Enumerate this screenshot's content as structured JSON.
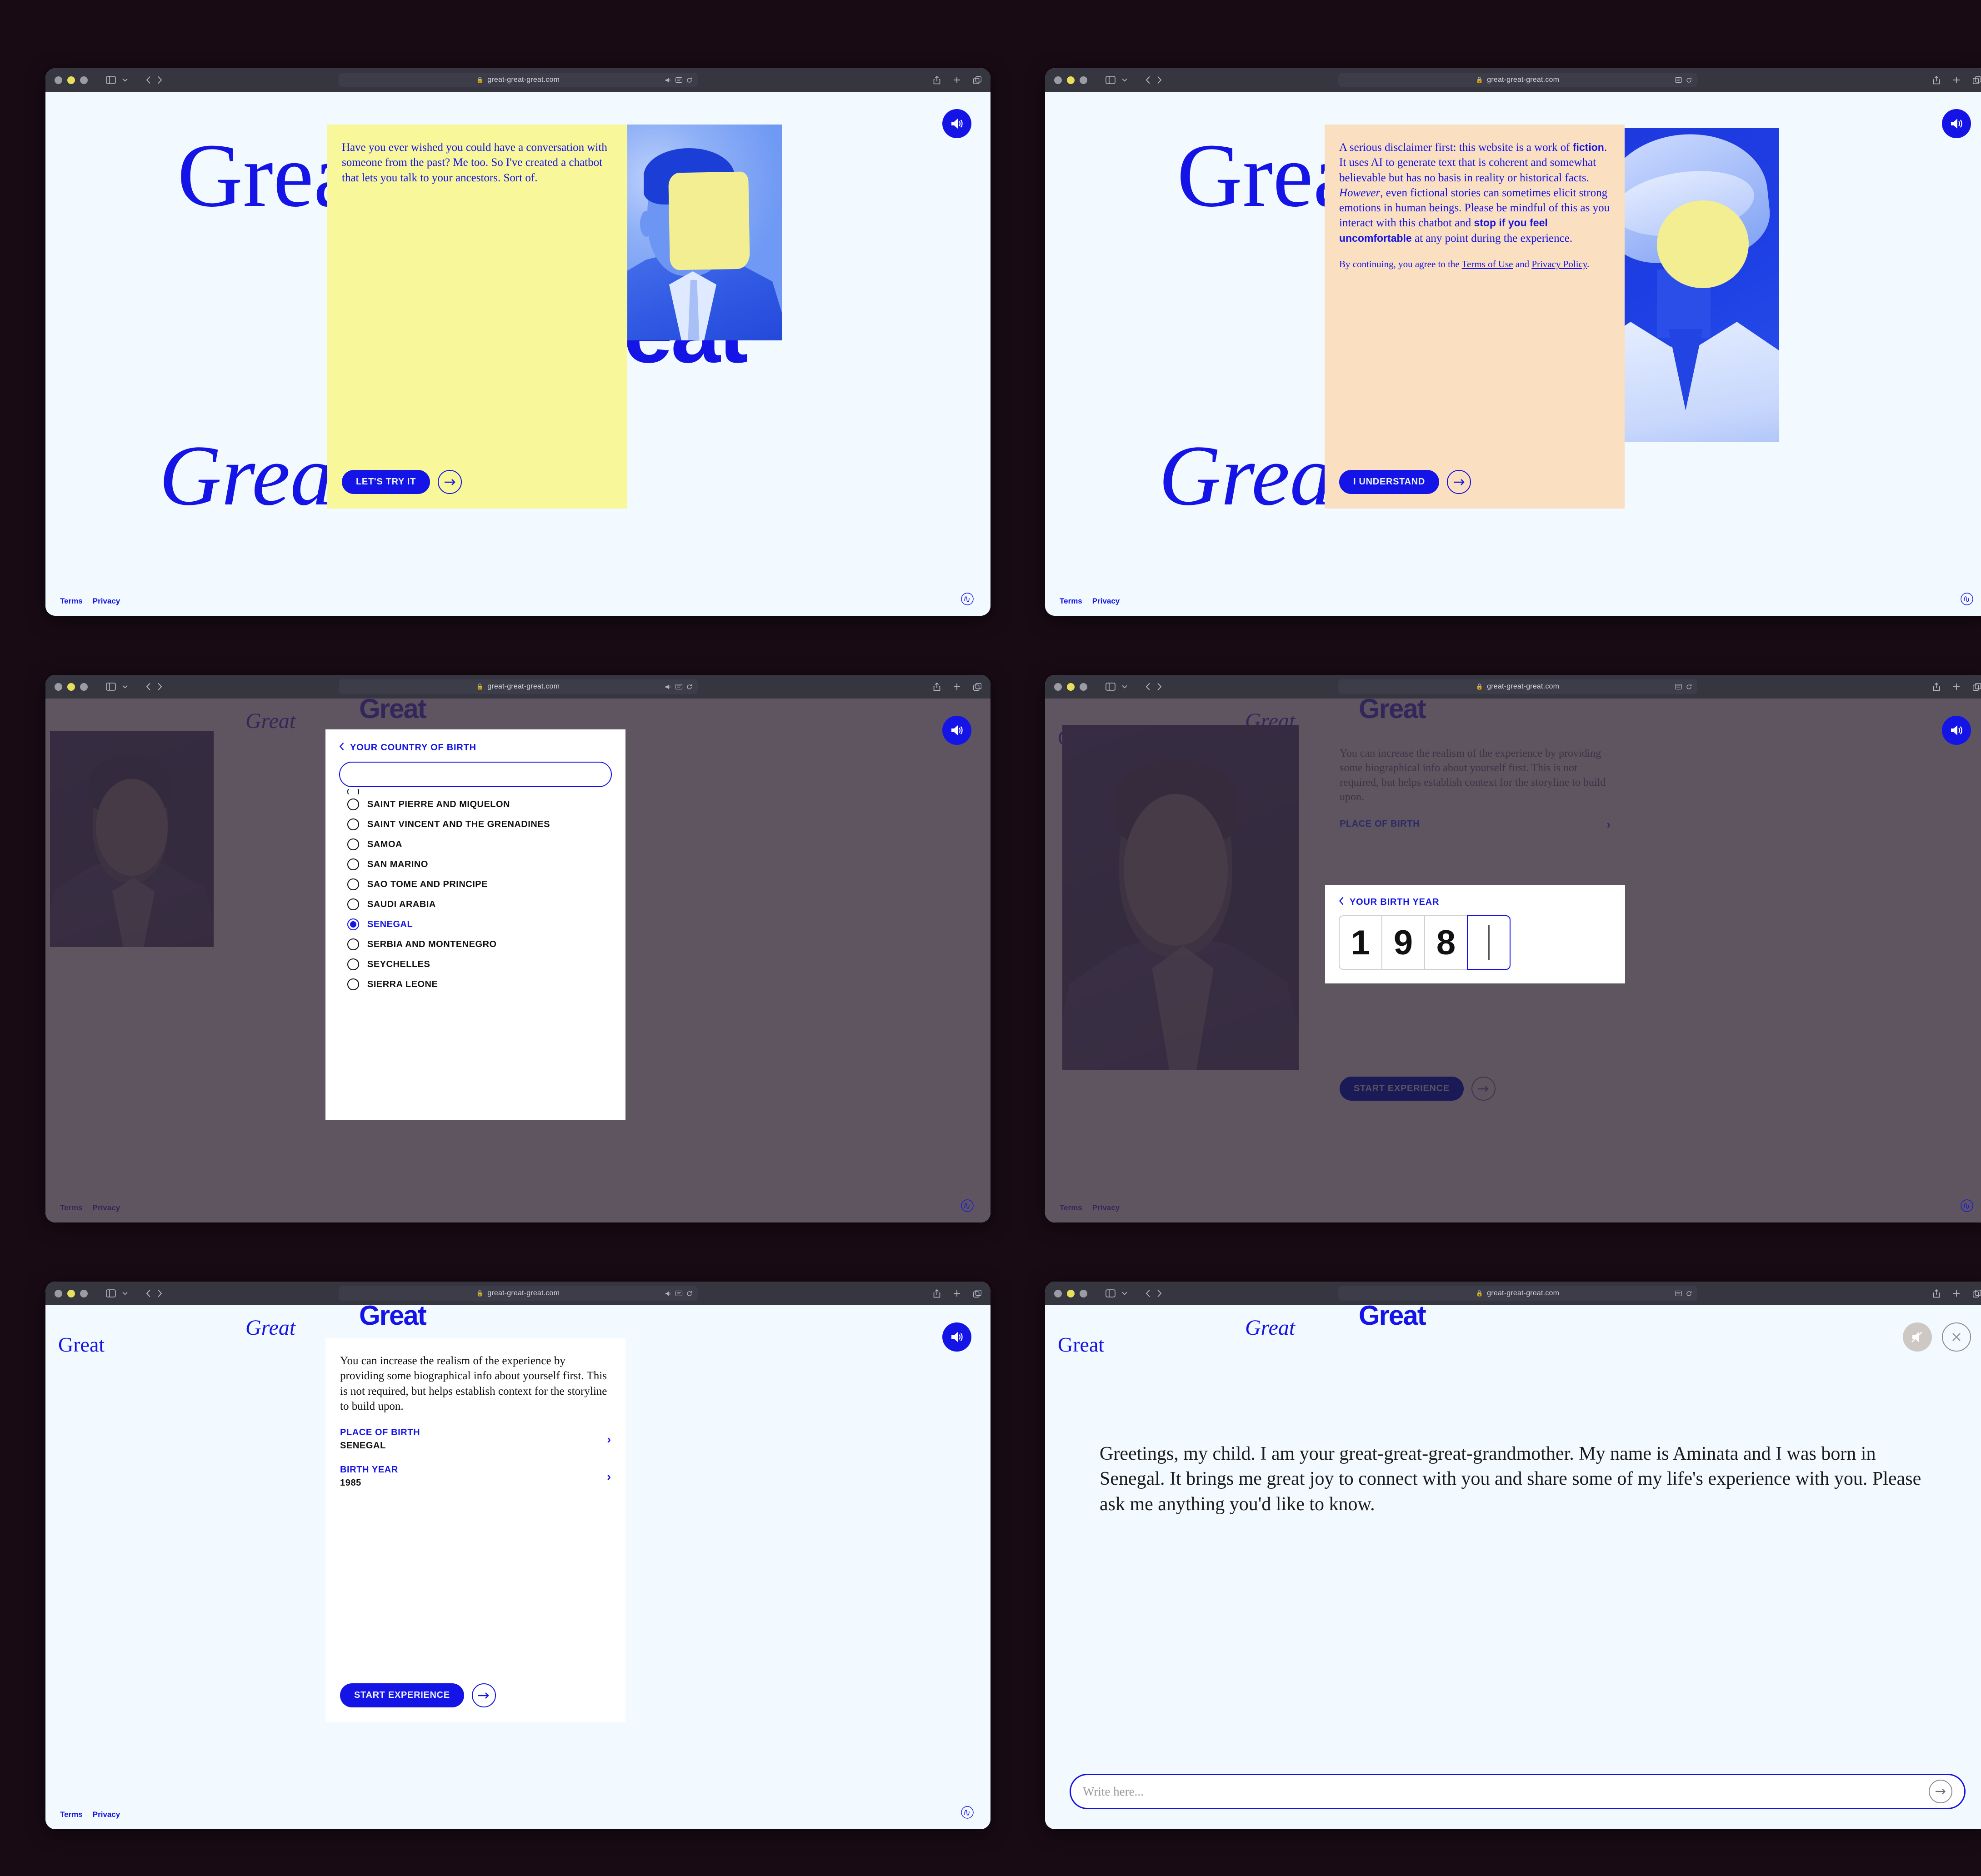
{
  "browser": {
    "url": "great-great-great.com",
    "lock_icon": "lock-icon",
    "back_icon": "chevron-left-icon",
    "forward_icon": "chevron-right-icon",
    "sidebar_icon": "sidebar-toggle-icon",
    "share_icon": "share-icon",
    "newtab_icon": "plus-icon",
    "tabs_icon": "tab-overview-icon",
    "reload_icon": "reload-icon",
    "reader_icon": "reader-view-icon",
    "audio_icon": "audio-playing-icon"
  },
  "brand": {
    "wordmark": "Great",
    "wordmark_bold": "Great",
    "wordmark_italic": "Great"
  },
  "footer": {
    "terms": "Terms",
    "privacy": "Privacy",
    "signature_mark": "signature-monogram"
  },
  "screens": {
    "intro": {
      "card_text": "Have you ever wished you could have a conversation with someone from the past? Me too. So I've created a chatbot that lets you talk to your ancestors. Sort of.",
      "cta_label": "LET'S TRY IT",
      "sound_icon": "speaker-on-icon",
      "arrow_icon": "arrow-right-icon"
    },
    "disclaimer": {
      "p1_a": "A serious disclaimer first: this website is a work of ",
      "p1_bold1": "fiction",
      "p1_b": ". It uses AI to generate text that is coherent and somewhat believable but has no basis in reality or historical facts. ",
      "p1_italic": "However",
      "p1_c": ", even fictional stories can sometimes elicit strong emotions in human beings. Please be mindful of this as you interact with this chatbot and ",
      "p1_bold2": "stop if you feel uncomfortable",
      "p1_d": " at any point during the experience.",
      "p2_a": "By continuing, you agree to the ",
      "p2_link1": "Terms of Use",
      "p2_b": " and ",
      "p2_link2": "Privacy Policy",
      "p2_c": ".",
      "cta_label": "I UNDERSTAND"
    },
    "country_select": {
      "title": "YOUR COUNTRY OF BIRTH",
      "back_icon": "chevron-left-icon",
      "search_value": "",
      "search_placeholder": "",
      "options": [
        {
          "label": "SAINT PIERRE AND MIQUELON",
          "selected": false
        },
        {
          "label": "SAINT VINCENT AND THE GRENADINES",
          "selected": false
        },
        {
          "label": "SAMOA",
          "selected": false
        },
        {
          "label": "SAN MARINO",
          "selected": false
        },
        {
          "label": "SAO TOME AND PRINCIPE",
          "selected": false
        },
        {
          "label": "SAUDI ARABIA",
          "selected": false
        },
        {
          "label": "SENEGAL",
          "selected": true
        },
        {
          "label": "SERBIA AND MONTENEGRO",
          "selected": false
        },
        {
          "label": "SEYCHELLES",
          "selected": false
        },
        {
          "label": "SIERRA LEONE",
          "selected": false
        }
      ]
    },
    "bio_intro": {
      "text": "You can increase the realism of the experience by providing some biographical info about yourself first. This is not required, but helps establish context for the storyline to build upon.",
      "place_key": "PLACE OF BIRTH",
      "place_value": "SENEGAL",
      "year_key": "BIRTH YEAR",
      "year_value": "1985",
      "cta_label": "START EXPERIENCE",
      "chevron_icon": "chevron-right-icon"
    },
    "year_select": {
      "title": "YOUR BIRTH YEAR",
      "back_icon": "chevron-left-icon",
      "digits": [
        "1",
        "9",
        "8",
        ""
      ],
      "active_index": 3
    },
    "chat": {
      "message": "Greetings, my child. I am your great-great-great-grandmother. My name is Aminata and I was born in Senegal. It brings me great joy to connect with you and share some of my life's experience with you. Please ask me anything you'd like to know.",
      "input_value": "",
      "input_placeholder": "Write here...",
      "send_icon": "arrow-right-icon",
      "mute_icon": "speaker-muted-icon",
      "close_icon": "close-icon"
    }
  },
  "colors": {
    "blue": "#1414e6",
    "yellow": "#f8f79a",
    "peach": "#fadfc0",
    "page_bg": "#f2faff",
    "desktop_bg": "#190b14"
  }
}
